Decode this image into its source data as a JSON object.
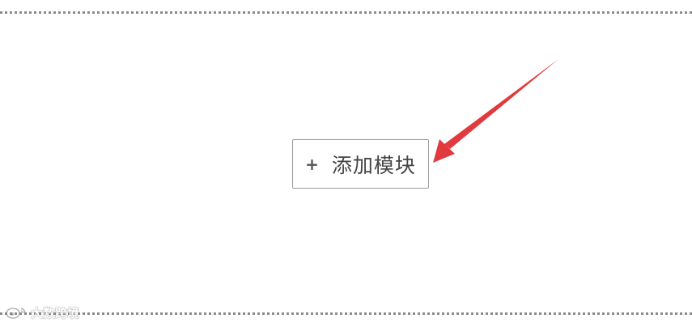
{
  "canvas": {
    "add_button": {
      "icon": "plus-icon",
      "icon_glyph": "+",
      "label": "添加模块"
    },
    "annotation": {
      "type": "arrow",
      "color": "#e03a3e",
      "points_to": "add-module-button"
    }
  },
  "watermark": {
    "text": "大数跨境",
    "logo": "weibo-logo-icon"
  },
  "colors": {
    "border": "#9a9a9a",
    "dotted_divider": "#8a8a8a",
    "text": "#444444"
  }
}
